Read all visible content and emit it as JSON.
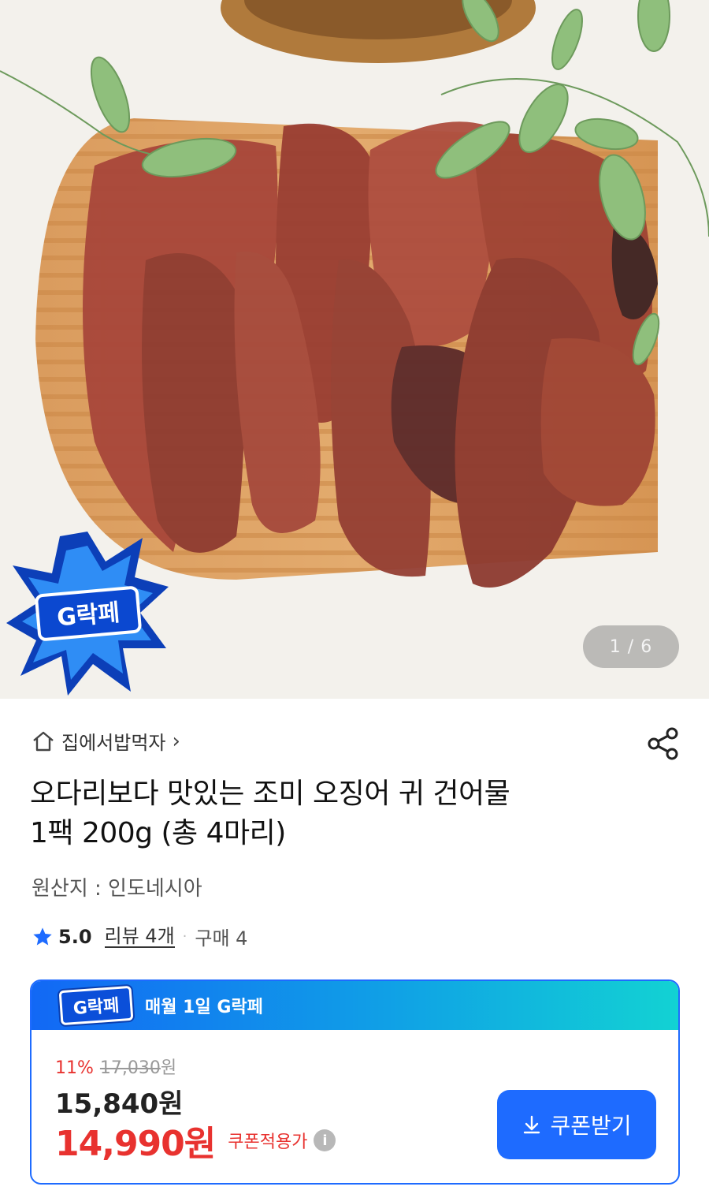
{
  "gallery": {
    "counter": "1 / 6",
    "badge_text": "G락페"
  },
  "seller": {
    "name": "집에서밥먹자",
    "chevron": "›",
    "icon": "home-icon"
  },
  "share_icon": "share-icon",
  "product": {
    "title_line1": "오다리보다 맛있는 조미 오징어 귀 건어물",
    "title_line2": "1팩 200g (총 4마리)",
    "origin": "원산지 : 인도네시아"
  },
  "rating": {
    "score": "5.0",
    "reviews": "리뷰 4개",
    "separator": "·",
    "purchases": "구매 4",
    "star_color": "#1e6bff"
  },
  "coupon_card": {
    "logo_text": "G락페",
    "header": "매월 1일 G락페",
    "discount_pct": "11%",
    "original_price": "17,030",
    "original_unit": "원",
    "price": "15,840원",
    "coupon_price": "14,990원",
    "coupon_label": "쿠폰적용가",
    "info_icon": "i",
    "button_label": "쿠폰받기",
    "accent": "#1e6bff",
    "discount_color": "#e8322f"
  }
}
